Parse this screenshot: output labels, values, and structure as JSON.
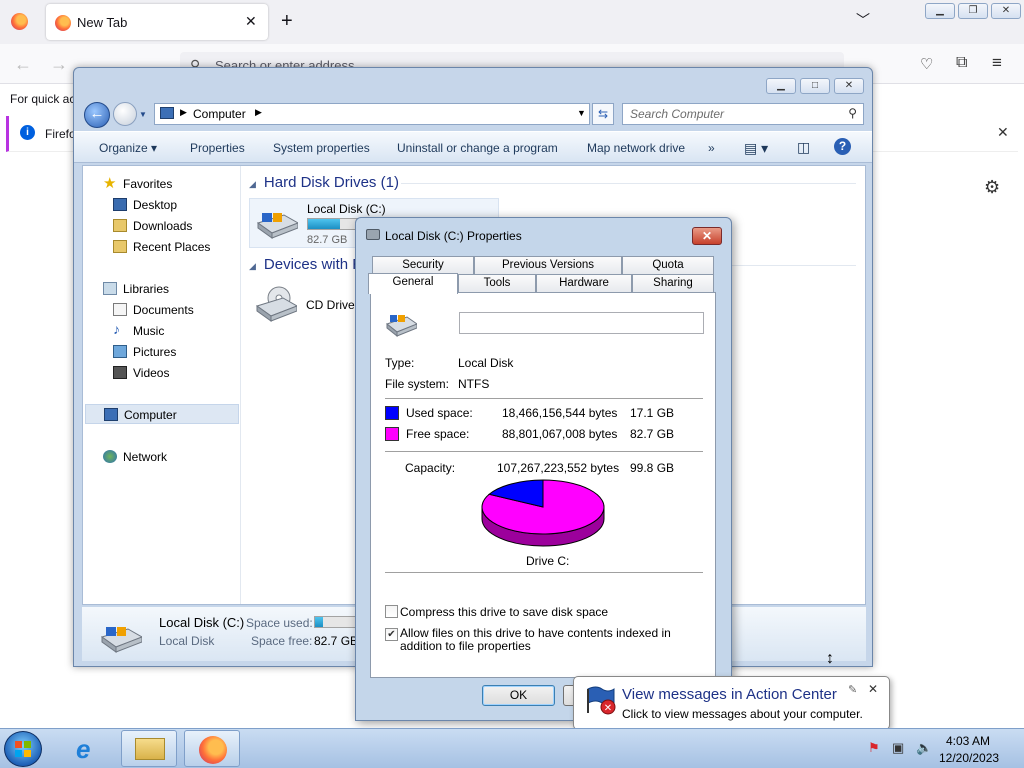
{
  "firefox": {
    "tab_title": "New Tab",
    "url_placeholder": "Search or enter address",
    "quick_access_text": "For quick ac",
    "notice_text": "Firefo"
  },
  "explorer": {
    "breadcrumb": "Computer",
    "search_placeholder": "Search Computer",
    "toolbar": {
      "organize": "Organize ▾",
      "properties": "Properties",
      "system_properties": "System properties",
      "uninstall": "Uninstall or change a program",
      "map_network": "Map network drive",
      "more": "»"
    },
    "nav": {
      "favorites": "Favorites",
      "desktop": "Desktop",
      "downloads": "Downloads",
      "recent_places": "Recent Places",
      "libraries": "Libraries",
      "documents": "Documents",
      "music": "Music",
      "pictures": "Pictures",
      "videos": "Videos",
      "computer": "Computer",
      "network": "Network"
    },
    "groups": {
      "hard_disk": "Hard Disk Drives (1)",
      "removable": "Devices with R"
    },
    "drives": {
      "local_disk_name": "Local Disk (C:)",
      "local_disk_free": "82.7 GB",
      "local_disk_used_fraction": 0.172,
      "cd_drive_name": "CD Drive"
    },
    "details": {
      "name": "Local Disk (C:)",
      "type": "Local Disk",
      "space_used_label": "Space used:",
      "space_free_label": "Space free:",
      "space_free_value": "82.7 GB"
    }
  },
  "properties": {
    "title": "Local Disk (C:) Properties",
    "tabs_back": [
      "Security",
      "Previous Versions",
      "Quota"
    ],
    "tabs_front": [
      "General",
      "Tools",
      "Hardware",
      "Sharing"
    ],
    "label_value": "",
    "type_label": "Type:",
    "type_value": "Local Disk",
    "fs_label": "File system:",
    "fs_value": "NTFS",
    "used_label": "Used space:",
    "used_bytes": "18,466,156,544 bytes",
    "used_gb": "17.1 GB",
    "free_label": "Free space:",
    "free_bytes": "88,801,067,008 bytes",
    "free_gb": "82.7 GB",
    "capacity_label": "Capacity:",
    "capacity_bytes": "107,267,223,552 bytes",
    "capacity_gb": "99.8 GB",
    "drive_label": "Drive C:",
    "compress_label": "Compress this drive to save disk space",
    "compress_checked": false,
    "index_label": "Allow files on this drive to have contents indexed in addition to file properties",
    "index_checked": true,
    "ok_label": "OK",
    "used_fraction": 0.172,
    "colors": {
      "used": "#0000ff",
      "free": "#ff00ff"
    }
  },
  "balloon": {
    "title": "View messages in Action Center",
    "text": "Click to view messages about your computer."
  },
  "taskbar": {
    "time": "4:03 AM",
    "date": "12/20/2023"
  }
}
